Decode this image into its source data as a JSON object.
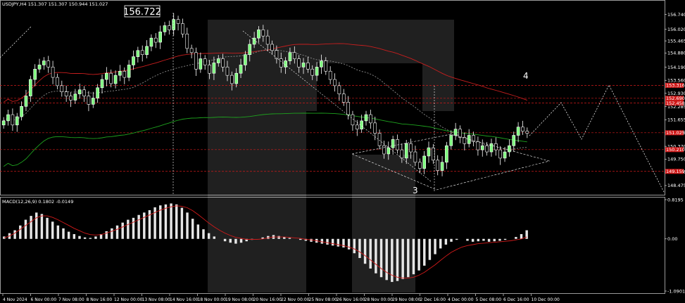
{
  "colors": {
    "background": "#000000",
    "bull_candle": "#ffffff",
    "bull_body": "#7fff7f",
    "bear_candle": "#ffffff",
    "ma_red": "#c81e1e",
    "ma_green": "#1ea31e",
    "ma_gray": "#8c8c8c",
    "level_red": "#d11a1a",
    "macd_hist": "#e6e6e6",
    "macd_signal": "#d11a1a",
    "watermark": "#3a3a3a",
    "axis": "#ffffff"
  },
  "chart_data": [
    {
      "type": "candlestick",
      "title": "USDJPY,H4  151.307 151.307 150.944 151.027",
      "symbol": "USDJPY,H4",
      "ohlc_header": "151.307 151.307 150.944 151.027",
      "price_callout": "156.722",
      "wave_labels": [
        "3",
        "4"
      ],
      "ylim": [
        148.2,
        157.1
      ],
      "y_ticks": [
        "156.740",
        "156.020",
        "155.465",
        "154.880",
        "154.190",
        "153.560",
        "152.930",
        "152.285",
        "151.655",
        "151.025",
        "150.370",
        "149.750",
        "149.120",
        "148.475"
      ],
      "price_tags": [
        "153.316",
        "152.690",
        "152.458",
        "151.025",
        "150.210",
        "149.159"
      ],
      "x_ticks": [
        "4 Nov 2024",
        "6 Nov 00:00",
        "7 Nov 08:00",
        "8 Nov 16:00",
        "12 Nov 00:00",
        "13 Nov 08:00",
        "14 Nov 16:00",
        "18 Nov 00:00",
        "19 Nov 08:00",
        "20 Nov 16:00",
        "22 Nov 00:00",
        "25 Nov 08:00",
        "26 Nov 16:00",
        "28 Nov 00:00",
        "29 Nov 08:00",
        "2 Dec 16:00",
        "4 Dec 00:00",
        "5 Dec 08:00",
        "6 Dec 16:00",
        "10 Dec 00:00"
      ],
      "close": [
        151.6,
        151.9,
        151.4,
        151.8,
        152.3,
        152.8,
        153.6,
        154.1,
        154.3,
        154.5,
        154.2,
        153.7,
        153.3,
        153.0,
        152.8,
        152.6,
        152.9,
        153.1,
        152.8,
        152.4,
        152.7,
        153.2,
        153.6,
        153.9,
        153.4,
        153.8,
        154.0,
        153.7,
        154.3,
        154.7,
        155.0,
        154.8,
        155.2,
        155.6,
        155.4,
        155.9,
        156.2,
        156.0,
        156.5,
        156.3,
        155.8,
        155.1,
        154.9,
        154.1,
        154.6,
        154.3,
        153.9,
        154.4,
        154.6,
        154.2,
        153.8,
        153.4,
        153.9,
        154.3,
        154.8,
        155.3,
        155.6,
        156.0,
        155.7,
        155.3,
        155.0,
        154.6,
        154.2,
        154.5,
        154.9,
        154.6,
        154.2,
        154.4,
        154.1,
        153.8,
        154.2,
        154.5,
        154.0,
        153.6,
        153.3,
        152.9,
        152.5,
        151.9,
        151.4,
        151.2,
        151.6,
        151.9,
        151.5,
        151.0,
        150.4,
        150.0,
        150.3,
        150.7,
        150.2,
        149.8,
        150.5,
        150.1,
        149.6,
        149.3,
        149.9,
        150.3,
        149.7,
        149.2,
        149.6,
        150.4,
        150.9,
        151.2,
        150.8,
        150.5,
        150.9,
        150.6,
        150.2,
        150.4,
        150.1,
        150.5,
        150.2,
        149.8,
        150.1,
        150.4,
        150.9,
        151.3,
        151.1,
        151.0
      ],
      "indicator": {
        "name": "MACD(12,26,9)",
        "header": "MACD(12,26,9) 0.1802 -0.0149",
        "ylim": [
          -1.0901,
          0.8195
        ],
        "y_ticks": [
          "0.8195",
          "0.00",
          "-1.0901"
        ],
        "macd": [
          0.05,
          0.12,
          0.18,
          0.28,
          0.4,
          0.48,
          0.55,
          0.52,
          0.44,
          0.36,
          0.28,
          0.22,
          0.15,
          0.1,
          0.06,
          0.03,
          0.02,
          0.05,
          0.1,
          0.16,
          0.22,
          0.28,
          0.34,
          0.4,
          0.44,
          0.5,
          0.55,
          0.6,
          0.66,
          0.7,
          0.72,
          0.74,
          0.72,
          0.65,
          0.55,
          0.42,
          0.3,
          0.2,
          0.12,
          0.05,
          0.0,
          -0.05,
          -0.08,
          -0.1,
          -0.08,
          -0.05,
          -0.02,
          0.0,
          0.03,
          0.06,
          0.08,
          0.06,
          0.04,
          0.02,
          0.0,
          -0.02,
          -0.04,
          -0.06,
          -0.08,
          -0.1,
          -0.12,
          -0.14,
          -0.16,
          -0.18,
          -0.22,
          -0.3,
          -0.4,
          -0.52,
          -0.62,
          -0.72,
          -0.8,
          -0.86,
          -0.9,
          -0.88,
          -0.84,
          -0.8,
          -0.74,
          -0.66,
          -0.56,
          -0.44,
          -0.32,
          -0.2,
          -0.12,
          -0.06,
          -0.02,
          0.0,
          -0.04,
          -0.06,
          -0.05,
          -0.04,
          -0.06,
          -0.05,
          -0.04,
          -0.02,
          0.0,
          0.04,
          0.1,
          0.18
        ],
        "signal": [
          0.02,
          0.06,
          0.12,
          0.2,
          0.28,
          0.36,
          0.44,
          0.48,
          0.48,
          0.45,
          0.4,
          0.34,
          0.28,
          0.22,
          0.17,
          0.12,
          0.09,
          0.08,
          0.09,
          0.12,
          0.16,
          0.2,
          0.25,
          0.3,
          0.35,
          0.4,
          0.45,
          0.5,
          0.55,
          0.6,
          0.64,
          0.67,
          0.69,
          0.68,
          0.65,
          0.59,
          0.51,
          0.42,
          0.33,
          0.25,
          0.18,
          0.12,
          0.07,
          0.03,
          0.01,
          -0.01,
          -0.01,
          -0.01,
          0.0,
          0.02,
          0.04,
          0.04,
          0.04,
          0.03,
          0.02,
          0.01,
          -0.01,
          -0.02,
          -0.04,
          -0.06,
          -0.08,
          -0.1,
          -0.12,
          -0.14,
          -0.17,
          -0.21,
          -0.27,
          -0.35,
          -0.44,
          -0.53,
          -0.62,
          -0.7,
          -0.76,
          -0.8,
          -0.82,
          -0.82,
          -0.8,
          -0.76,
          -0.7,
          -0.62,
          -0.54,
          -0.45,
          -0.36,
          -0.28,
          -0.22,
          -0.17,
          -0.14,
          -0.12,
          -0.1,
          -0.09,
          -0.08,
          -0.07,
          -0.06,
          -0.05,
          -0.04,
          -0.02,
          0.0,
          0.04
        ]
      }
    }
  ]
}
